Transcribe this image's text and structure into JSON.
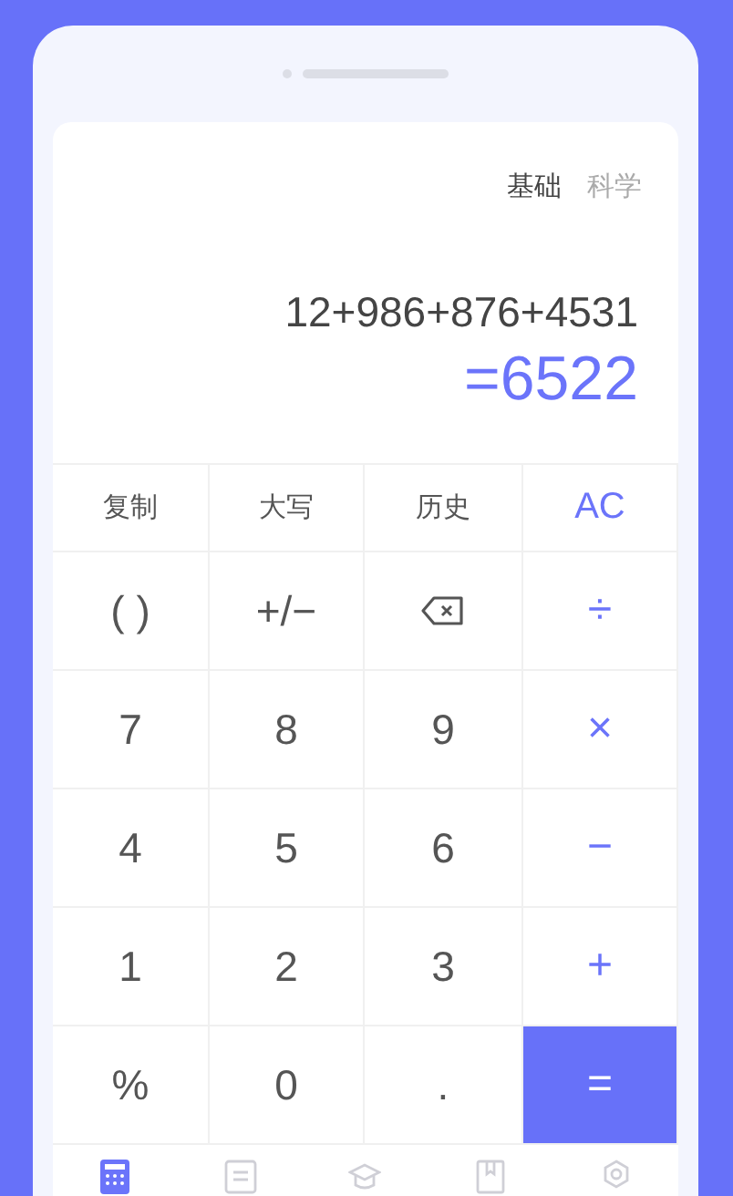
{
  "tabs": [
    {
      "label": "基础",
      "selected": true
    },
    {
      "label": "科学",
      "selected": false
    }
  ],
  "expression": "12+986+876+4531",
  "result": "=6522",
  "function_keys": [
    {
      "label": "复制",
      "kind": "text"
    },
    {
      "label": "大写",
      "kind": "text"
    },
    {
      "label": "历史",
      "kind": "text"
    },
    {
      "label": "AC",
      "kind": "accent"
    }
  ],
  "keys": [
    {
      "label": "( )",
      "kind": "digit"
    },
    {
      "label": "+/−",
      "kind": "digit"
    },
    {
      "kind": "backspace"
    },
    {
      "label": "÷",
      "kind": "operator"
    },
    {
      "label": "7",
      "kind": "digit"
    },
    {
      "label": "8",
      "kind": "digit"
    },
    {
      "label": "9",
      "kind": "digit"
    },
    {
      "label": "×",
      "kind": "operator"
    },
    {
      "label": "4",
      "kind": "digit"
    },
    {
      "label": "5",
      "kind": "digit"
    },
    {
      "label": "6",
      "kind": "digit"
    },
    {
      "label": "−",
      "kind": "operator"
    },
    {
      "label": "1",
      "kind": "digit"
    },
    {
      "label": "2",
      "kind": "digit"
    },
    {
      "label": "3",
      "kind": "digit"
    },
    {
      "label": "+",
      "kind": "operator"
    },
    {
      "label": "%",
      "kind": "digit"
    },
    {
      "label": "0",
      "kind": "digit"
    },
    {
      "label": ".",
      "kind": "digit"
    },
    {
      "label": "=",
      "kind": "equals"
    }
  ],
  "nav": [
    {
      "kind": "calculator",
      "selected": true
    },
    {
      "kind": "convert",
      "selected": false
    },
    {
      "kind": "education",
      "selected": false
    },
    {
      "kind": "book",
      "selected": false
    },
    {
      "kind": "settings",
      "selected": false
    }
  ]
}
